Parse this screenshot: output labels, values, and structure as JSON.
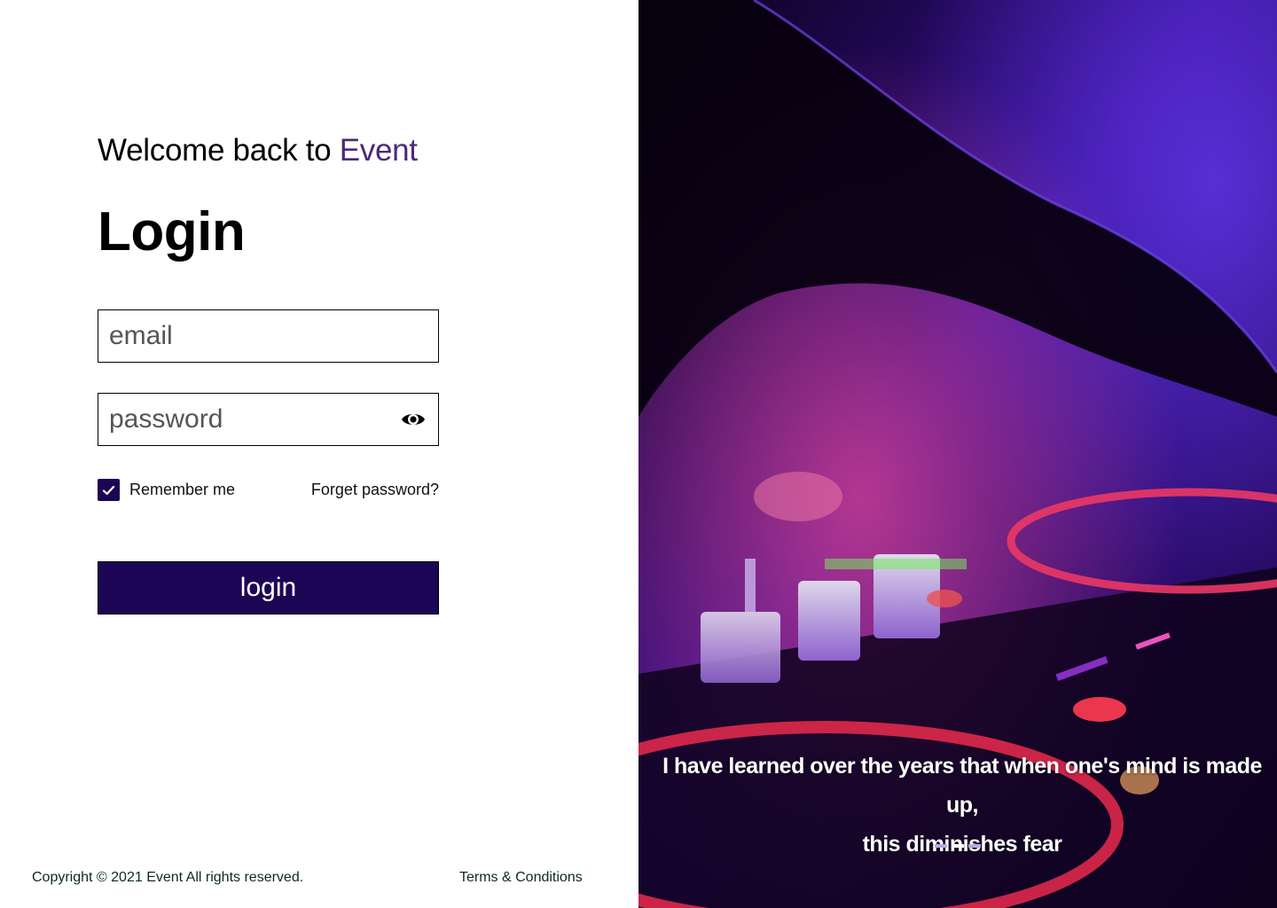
{
  "header": {
    "welcome_prefix": "Welcome back to ",
    "brand_name": "Event",
    "title": "Login"
  },
  "form": {
    "email_placeholder": "email",
    "email_value": "",
    "password_placeholder": "password",
    "password_value": "",
    "remember_label": "Remember me",
    "remember_checked": true,
    "forgot_label": "Forget password?",
    "submit_label": "login"
  },
  "footer": {
    "copyright": "Copyright © 2021 Event All rights reserved.",
    "terms": "Terms & Conditions"
  },
  "hero": {
    "quote_line1": "I have learned over the years that when one's mind is made up,",
    "quote_line2": "this diminishes fear",
    "carousel_count": 3,
    "carousel_active": 2
  },
  "colors": {
    "brand_purple": "#4f2878",
    "button_dark": "#1d0555",
    "footer_text": "#0b2a1f"
  },
  "icons": [
    "eye-icon",
    "check-icon"
  ]
}
